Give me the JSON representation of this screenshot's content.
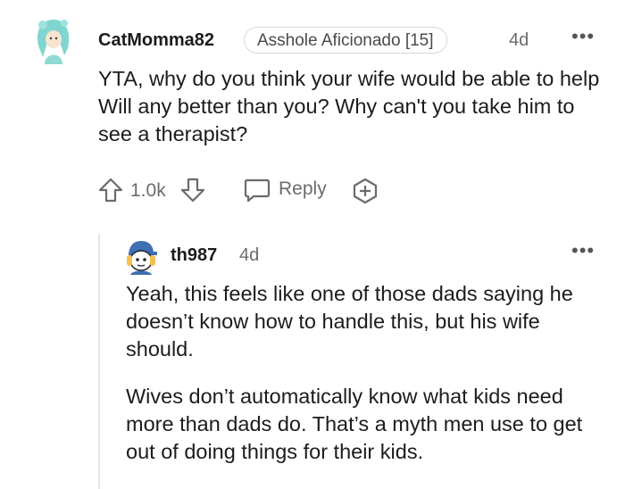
{
  "comment": {
    "username": "CatMomma82",
    "flair": "Asshole Aficionado [15]",
    "time": "4d",
    "text": "YTA, why do you think your wife would be able to help Will any better than you? Why can't you take him to see a therapist?",
    "votes": "1.0k",
    "reply_label": "Reply"
  },
  "reply": {
    "username": "th987",
    "time": "4d",
    "paragraphs": [
      "Yeah, this feels like one of those dads saying he doesn’t know how to handle this, but his wife should.",
      "Wives don’t automatically know what kids need more than dads do. That’s a myth men use to get out of doing things for their kids."
    ]
  },
  "icons": {
    "upvote": "arrow-up-icon",
    "downvote": "arrow-down-icon",
    "reply": "speech-bubble-icon",
    "award": "add-award-icon",
    "more": "more-options-icon"
  }
}
